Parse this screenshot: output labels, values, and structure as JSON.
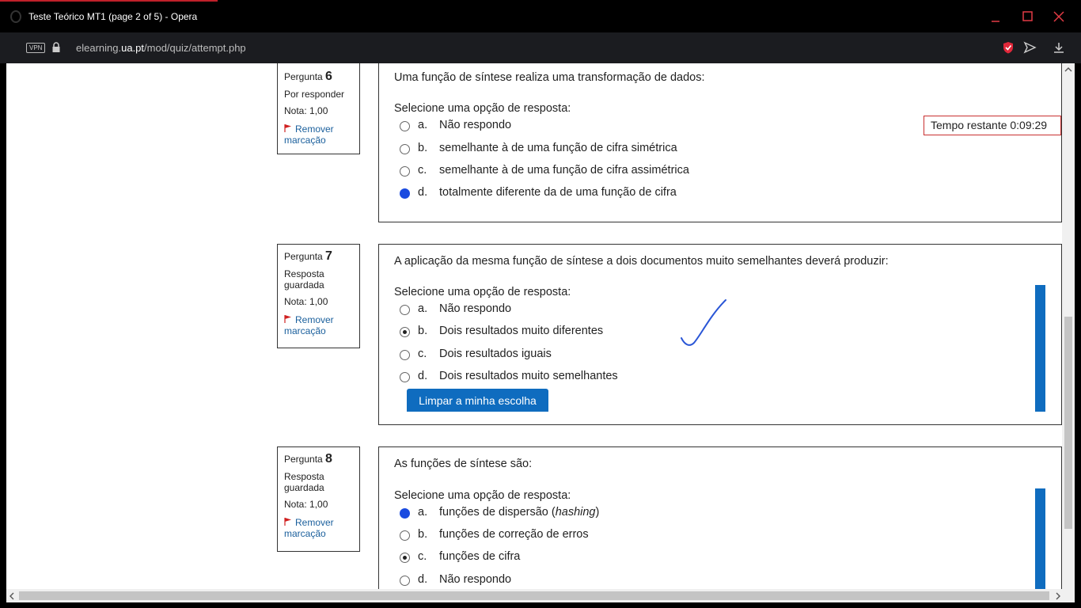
{
  "window": {
    "title": "Teste Teórico MT1 (page 2 of 5) - Opera"
  },
  "addressbar": {
    "vpn": "VPN",
    "url_pre": "elearning.",
    "url_domain": "ua.pt",
    "url_path": "/mod/quiz/attempt.php"
  },
  "timer": {
    "text": "Tempo restante 0:09:29"
  },
  "questions": [
    {
      "label": "Pergunta",
      "number": "6",
      "state": "Por responder",
      "grade": "Nota: 1,00",
      "flag": "Remover marcação",
      "text": "Uma função de síntese realiza uma transformação de dados:",
      "prompt": "Selecione uma opção de resposta:",
      "options": [
        {
          "letter": "a.",
          "text": "Não respondo"
        },
        {
          "letter": "b.",
          "text": "semelhante à de uma função de cifra simétrica"
        },
        {
          "letter": "c.",
          "text": "semelhante à de uma função de cifra assimétrica"
        },
        {
          "letter": "d.",
          "text": "totalmente diferente da de uma função de cifra"
        }
      ]
    },
    {
      "label": "Pergunta",
      "number": "7",
      "state": "Resposta guardada",
      "grade": "Nota: 1,00",
      "flag": "Remover marcação",
      "text": "A aplicação da mesma função de síntese a dois documentos muito semelhantes deverá produzir:",
      "prompt": "Selecione uma opção de resposta:",
      "options": [
        {
          "letter": "a.",
          "text": "Não respondo"
        },
        {
          "letter": "b.",
          "text": "Dois resultados muito diferentes"
        },
        {
          "letter": "c.",
          "text": "Dois resultados iguais"
        },
        {
          "letter": "d.",
          "text": "Dois resultados muito semelhantes"
        }
      ],
      "clear_button": "Limpar a minha escolha"
    },
    {
      "label": "Pergunta",
      "number": "8",
      "state": "Resposta guardada",
      "grade": "Nota: 1,00",
      "flag": "Remover marcação",
      "text": "As funções de síntese são:",
      "prompt": "Selecione uma opção de resposta:",
      "options": [
        {
          "letter": "a.",
          "text_pre": "funções de dispersão (",
          "text_em": "hashing",
          "text_post": ")"
        },
        {
          "letter": "b.",
          "text": "funções de correção de erros"
        },
        {
          "letter": "c.",
          "text": "funções de cifra"
        },
        {
          "letter": "d.",
          "text": "Não respondo"
        }
      ]
    }
  ]
}
